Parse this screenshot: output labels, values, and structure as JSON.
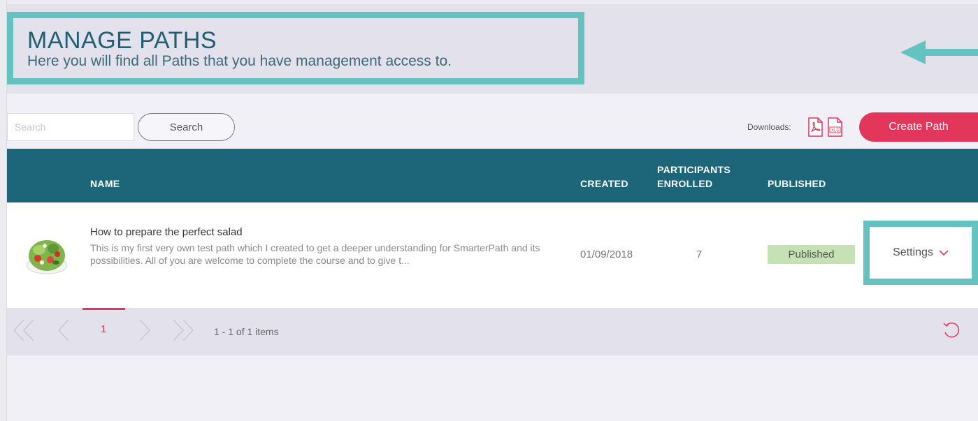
{
  "header": {
    "title": "MANAGE PATHS",
    "subtitle": "Here you will find all Paths that you have management access to."
  },
  "toolbar": {
    "search_placeholder": "Search",
    "search_label": "Search",
    "downloads_label": "Downloads:",
    "create_label": "Create Path"
  },
  "table": {
    "columns": {
      "name": "NAME",
      "created": "CREATED",
      "participants": "PARTICIPANTS ENROLLED",
      "published": "PUBLISHED"
    },
    "rows": [
      {
        "title": "How to prepare the perfect salad",
        "description": "This is my first very own test path which I created to get a deeper understanding for SmarterPath and its possibilities. All of you are welcome to complete the course and to give t...",
        "created": "01/09/2018",
        "participants": "7",
        "status": "Published",
        "settings_label": "Settings"
      }
    ]
  },
  "pager": {
    "current_page": "1",
    "info": "1 - 1 of 1 items"
  },
  "colors": {
    "header_band": "#1d667a",
    "accent": "#e2365a",
    "highlight": "#64c2c0",
    "published_badge": "#c6e2b5"
  },
  "icons": {
    "pdf": "pdf-download-icon",
    "xls": "xls-download-icon",
    "first": "first-page-icon",
    "prev": "prev-page-icon",
    "next": "next-page-icon",
    "last": "last-page-icon",
    "refresh": "refresh-icon",
    "settings": "chevron-down-icon"
  }
}
